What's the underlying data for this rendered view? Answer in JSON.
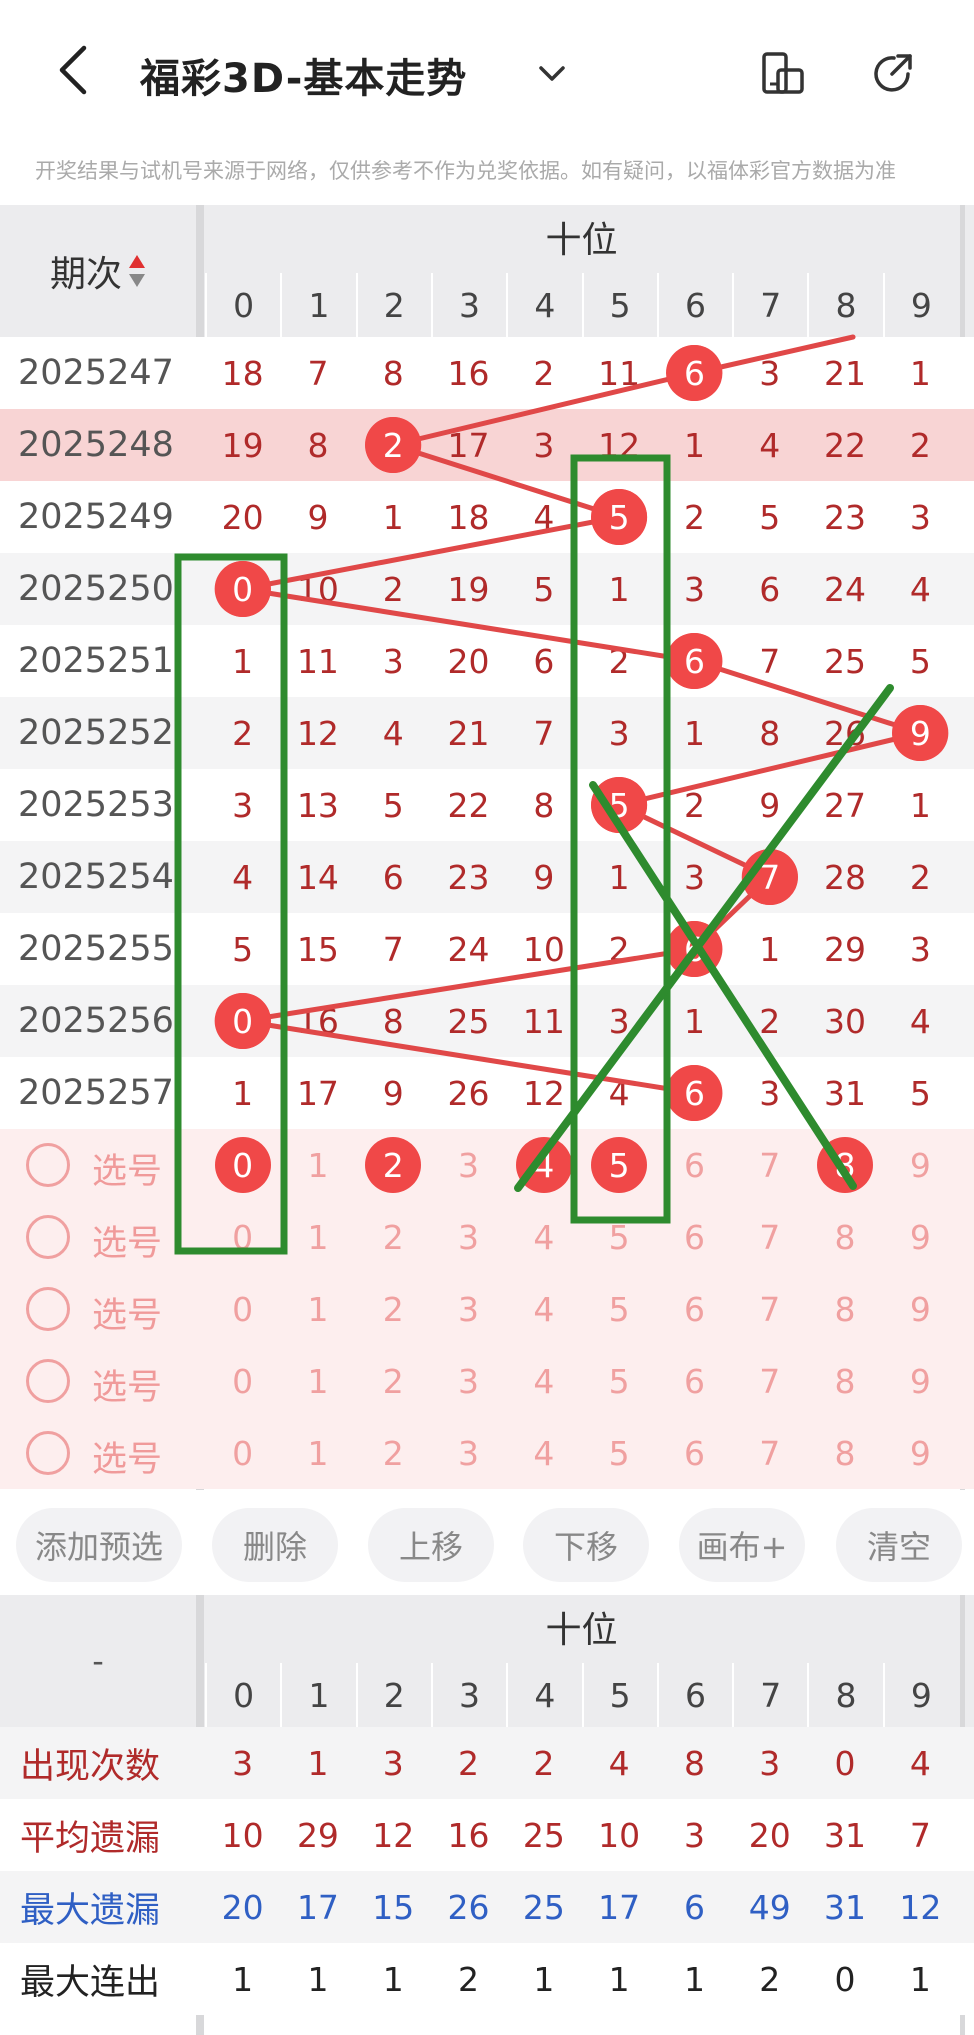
{
  "header": {
    "title": "福彩3D-基本走势",
    "notice": "开奖结果与试机号来源于网络，仅供参考不作为兑奖依据。如有疑问，以福体彩官方数据为准"
  },
  "table": {
    "section_title": "十位",
    "period_header": "期次",
    "digits": [
      "0",
      "1",
      "2",
      "3",
      "4",
      "5",
      "6",
      "7",
      "8",
      "9"
    ],
    "rows": [
      {
        "period": "2025247",
        "vals": [
          "18",
          "7",
          "8",
          "16",
          "2",
          "11",
          "6",
          "3",
          "21",
          "1"
        ],
        "hit": 6
      },
      {
        "period": "2025248",
        "vals": [
          "19",
          "8",
          "2",
          "17",
          "3",
          "12",
          "1",
          "4",
          "22",
          "2"
        ],
        "hit": 2
      },
      {
        "period": "2025249",
        "vals": [
          "20",
          "9",
          "1",
          "18",
          "4",
          "5",
          "2",
          "5",
          "23",
          "3"
        ],
        "hit": 5
      },
      {
        "period": "2025250",
        "vals": [
          "0",
          "10",
          "2",
          "19",
          "5",
          "1",
          "3",
          "6",
          "24",
          "4"
        ],
        "hit": 0
      },
      {
        "period": "2025251",
        "vals": [
          "1",
          "11",
          "3",
          "20",
          "6",
          "2",
          "6",
          "7",
          "25",
          "5"
        ],
        "hit": 6
      },
      {
        "period": "2025252",
        "vals": [
          "2",
          "12",
          "4",
          "21",
          "7",
          "3",
          "1",
          "8",
          "26",
          "9"
        ],
        "hit": 9
      },
      {
        "period": "2025253",
        "vals": [
          "3",
          "13",
          "5",
          "22",
          "8",
          "5",
          "2",
          "9",
          "27",
          "1"
        ],
        "hit": 5
      },
      {
        "period": "2025254",
        "vals": [
          "4",
          "14",
          "6",
          "23",
          "9",
          "1",
          "3",
          "7",
          "28",
          "2"
        ],
        "hit": 7
      },
      {
        "period": "2025255",
        "vals": [
          "5",
          "15",
          "7",
          "24",
          "10",
          "2",
          "6",
          "1",
          "29",
          "3"
        ],
        "hit": 6
      },
      {
        "period": "2025256",
        "vals": [
          "0",
          "16",
          "8",
          "25",
          "11",
          "3",
          "1",
          "2",
          "30",
          "4"
        ],
        "hit": 0
      },
      {
        "period": "2025257",
        "vals": [
          "1",
          "17",
          "9",
          "26",
          "12",
          "4",
          "6",
          "3",
          "31",
          "5"
        ],
        "hit": 6
      }
    ],
    "select_label": "选号",
    "select_rows": [
      {
        "hits": [
          0,
          2,
          4,
          5,
          8
        ]
      },
      {
        "hits": []
      },
      {
        "hits": []
      },
      {
        "hits": []
      },
      {
        "hits": []
      }
    ]
  },
  "buttons": [
    "添加预选",
    "删除",
    "上移",
    "下移",
    "画布+",
    "清空"
  ],
  "stats": {
    "corner": "-",
    "section_title": "十位",
    "rows": [
      {
        "label": "出现次数",
        "vals": [
          "3",
          "1",
          "3",
          "2",
          "2",
          "4",
          "8",
          "3",
          "0",
          "4"
        ],
        "color": "#b02a2a"
      },
      {
        "label": "平均遗漏",
        "vals": [
          "10",
          "29",
          "12",
          "16",
          "25",
          "10",
          "3",
          "20",
          "31",
          "7"
        ],
        "color": "#b02a2a"
      },
      {
        "label": "最大遗漏",
        "vals": [
          "20",
          "17",
          "15",
          "26",
          "25",
          "17",
          "6",
          "49",
          "31",
          "12"
        ],
        "color": "#2f5fc4"
      },
      {
        "label": "最大连出",
        "vals": [
          "1",
          "1",
          "1",
          "2",
          "1",
          "1",
          "1",
          "2",
          "0",
          "1"
        ],
        "color": "#222"
      }
    ]
  },
  "colors": {
    "ball": "#f04848",
    "line": "#e04848",
    "annotation": "#2e8b2e",
    "highlight_row": "#f8d4d4",
    "select_bg": "#fdeeee"
  }
}
